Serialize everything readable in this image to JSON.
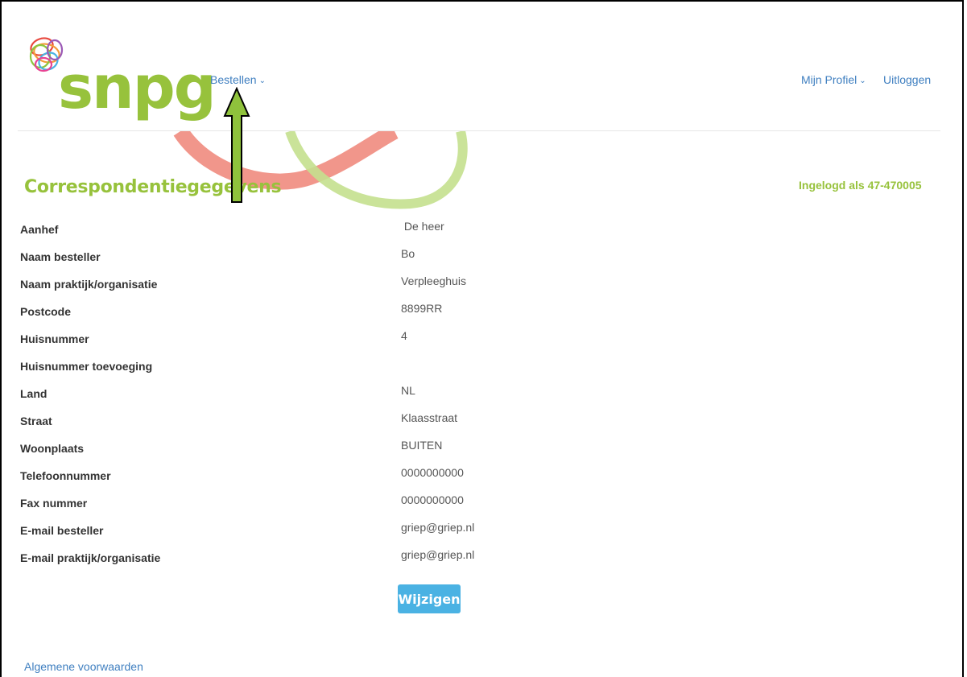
{
  "header": {
    "logo_text": "snpg",
    "nav_bestellen": "Bestellen",
    "nav_profiel": "Mijn Profiel",
    "nav_uitloggen": "Uitloggen"
  },
  "page": {
    "title": "Correspondentiegegevens",
    "logged_in": "Ingelogd als 47-470005"
  },
  "fields": [
    {
      "label": "Aanhef",
      "value": " De heer"
    },
    {
      "label": "Naam besteller",
      "value": "Bo"
    },
    {
      "label": "Naam praktijk/organisatie",
      "value": "Verpleeghuis"
    },
    {
      "label": "Postcode",
      "value": "8899RR"
    },
    {
      "label": "Huisnummer",
      "value": "4"
    },
    {
      "label": "Huisnummer toevoeging",
      "value": ""
    },
    {
      "label": "Land",
      "value": "NL"
    },
    {
      "label": "Straat",
      "value": "Klaasstraat"
    },
    {
      "label": "Woonplaats",
      "value": "BUITEN"
    },
    {
      "label": "Telefoonnummer",
      "value": "0000000000"
    },
    {
      "label": "Fax nummer",
      "value": "0000000000"
    },
    {
      "label": "E-mail besteller",
      "value": "griep@griep.nl"
    },
    {
      "label": "E-mail praktijk/organisatie",
      "value": "griep@griep.nl"
    }
  ],
  "actions": {
    "edit_label": "Wijzigen"
  },
  "footer": {
    "terms_link": "Algemene voorwaarden"
  },
  "colors": {
    "brand_green": "#97c23c",
    "link_blue": "#3f7fc0",
    "button_blue": "#4ab2e3",
    "annotation_arrow": "#8fc23c"
  },
  "icons": {
    "dropdown": "chevron-down-icon",
    "annotation": "up-arrow-icon"
  }
}
